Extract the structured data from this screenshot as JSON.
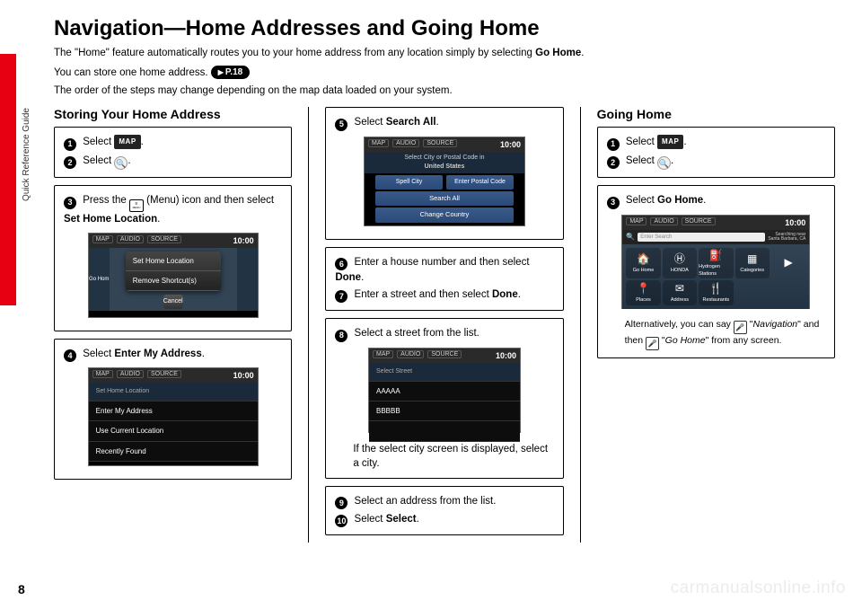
{
  "side_label": "Quick Reference Guide",
  "page_number": "8",
  "title": "Navigation—Home Addresses and Going Home",
  "intro": {
    "p1a": "The \"Home\" feature automatically routes you to your home address from any location simply by selecting ",
    "p1b": "Go Home",
    "p1c": ".",
    "p2a": "You can store one home address. ",
    "p2badge": "P.18",
    "p3": "The order of the steps may change depending on the map data loaded on your system."
  },
  "col1": {
    "heading": "Storing Your Home Address",
    "box1": {
      "s1a": "Select ",
      "s1map": "MAP",
      "s1b": ".",
      "s2a": "Select ",
      "s2b": "."
    },
    "box2": {
      "s3a": "Press the ",
      "s3b": " (Menu) icon and then select ",
      "s3c": "Set Home Location",
      "s3d": "."
    },
    "box3": {
      "s4a": "Select ",
      "s4b": "Enter My Address",
      "s4c": "."
    },
    "screen1": {
      "tabs": {
        "t1": "MAP",
        "t2": "AUDIO",
        "t3": "SOURCE"
      },
      "clock": "10:00",
      "d1": "Set Home Location",
      "d2": "Remove Shortcut(s)",
      "cancel": "Cancel"
    },
    "screen2": {
      "tabs": {
        "t1": "MAP",
        "t2": "AUDIO",
        "t3": "SOURCE"
      },
      "clock": "10:00",
      "sub": "Set Home Location",
      "l1": "Enter My Address",
      "l2": "Use Current Location",
      "l3": "Recently Found"
    }
  },
  "col2": {
    "box1": {
      "s5a": "Select ",
      "s5b": "Search All",
      "s5c": "."
    },
    "screen5": {
      "tabs": {
        "t1": "MAP",
        "t2": "AUDIO",
        "t3": "SOURCE"
      },
      "clock": "10:00",
      "sub1": "Select City or Postal Code in",
      "sub2": "United States",
      "b1a": "Spell City",
      "b1b": "Enter Postal Code",
      "b2": "Search All",
      "b3": "Change Country"
    },
    "box2": {
      "s6a": "Enter a house number and then select ",
      "s6b": "Done",
      "s6c": ".",
      "s7a": "Enter a street and then select ",
      "s7b": "Done",
      "s7c": "."
    },
    "box3": {
      "s8": "Select a street from the list.",
      "note": "If the select city screen is displayed, select a city."
    },
    "screen8": {
      "tabs": {
        "t1": "MAP",
        "t2": "AUDIO",
        "t3": "SOURCE"
      },
      "clock": "10:00",
      "sub": "Select Street",
      "l1": "AAAAA",
      "l2": "BBBBB"
    },
    "box4": {
      "s9": "Select an address from the list.",
      "s10a": "Select ",
      "s10b": "Select",
      "s10c": "."
    }
  },
  "col3": {
    "heading": "Going Home",
    "box1": {
      "s1a": "Select ",
      "s1map": "MAP",
      "s1b": ".",
      "s2a": "Select ",
      "s2b": "."
    },
    "box2": {
      "s3a": "Select ",
      "s3b": "Go Home",
      "s3c": "."
    },
    "screen3": {
      "tabs": {
        "t1": "MAP",
        "t2": "AUDIO",
        "t3": "SOURCE"
      },
      "clock": "10:00",
      "search_ph": "Enter Search",
      "loc1": "Searching near",
      "loc2": "Santa Barbara, CA",
      "tiles": {
        "t1": "Go Home",
        "t2": "HONDA",
        "t3": "Hydrogen Stations",
        "t4": "Categories",
        "t5": "",
        "t6": "Places",
        "t7": "Address",
        "t8": "Restaurants",
        "t9": ""
      }
    },
    "note": {
      "a": "Alternatively, you can say ",
      "b": " \"",
      "c": "Navigation",
      "d": "\" and then ",
      "e": " \"",
      "f": "Go Home",
      "g": "\" from any screen."
    }
  },
  "watermark": "carmanualsonline.info"
}
